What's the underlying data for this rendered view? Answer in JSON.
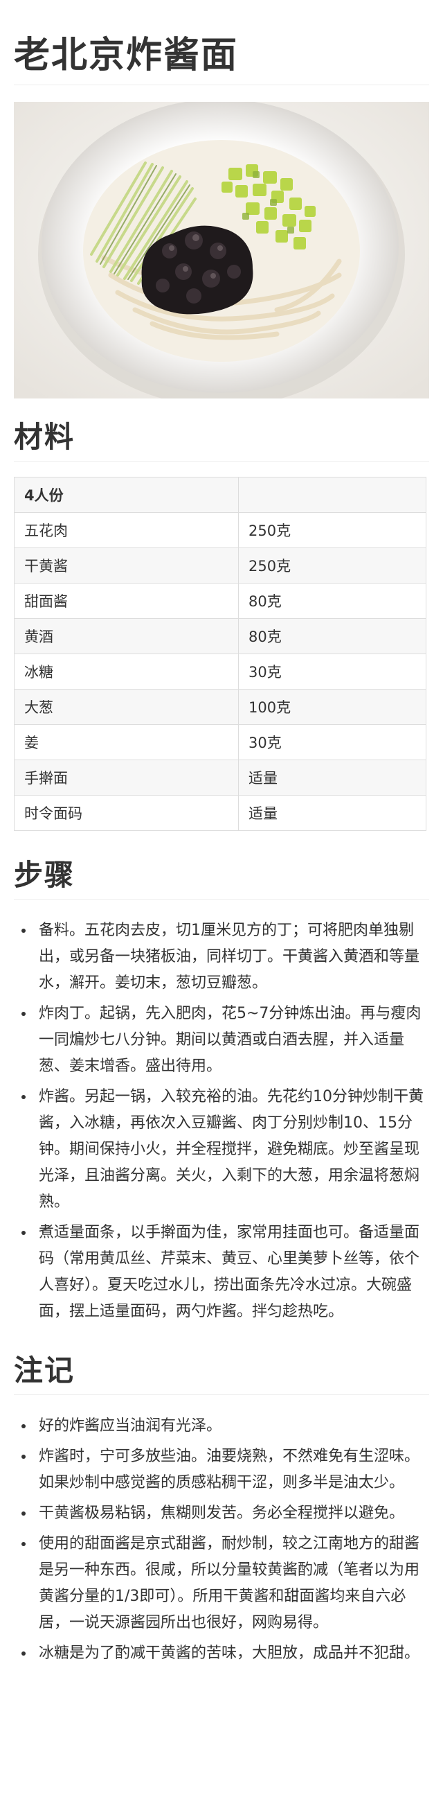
{
  "title": "老北京炸酱面",
  "hero_image": {
    "icon": "zhajiangmian-photo"
  },
  "materials": {
    "heading": "材料",
    "header": [
      "4人份",
      ""
    ],
    "rows": [
      [
        "五花肉",
        "250克"
      ],
      [
        "干黄酱",
        "250克"
      ],
      [
        "甜面酱",
        "80克"
      ],
      [
        "黄酒",
        "80克"
      ],
      [
        "冰糖",
        "30克"
      ],
      [
        "大葱",
        "100克"
      ],
      [
        "姜",
        "30克"
      ],
      [
        "手擀面",
        "适量"
      ],
      [
        "时令面码",
        "适量"
      ]
    ]
  },
  "steps": {
    "heading": "步骤",
    "items": [
      "备料。五花肉去皮，切1厘米见方的丁；可将肥肉单独剔出，或另备一块猪板油，同样切丁。干黄酱入黄酒和等量水，澥开。姜切末，葱切豆瓣葱。",
      "炸肉丁。起锅，先入肥肉，花5~7分钟炼出油。再与瘦肉一同煸炒七八分钟。期间以黄酒或白酒去腥，并入适量葱、姜末增香。盛出待用。",
      "炸酱。另起一锅，入较充裕的油。先花约10分钟炒制干黄酱，入冰糖，再依次入豆瓣酱、肉丁分别炒制10、15分钟。期间保持小火，并全程搅拌，避免糊底。炒至酱呈现光泽，且油酱分离。关火，入剩下的大葱，用余温将葱焖熟。",
      "煮适量面条，以手擀面为佳，家常用挂面也可。备适量面码（常用黄瓜丝、芹菜末、黄豆、心里美萝卜丝等，依个人喜好）。夏天吃过水儿，捞出面条先冷水过凉。大碗盛面，摆上适量面码，两勺炸酱。拌匀趁热吃。"
    ]
  },
  "notes": {
    "heading": "注记",
    "items": [
      "好的炸酱应当油润有光泽。",
      "炸酱时，宁可多放些油。油要烧熟，不然难免有生涩味。如果炒制中感觉酱的质感粘稠干涩，则多半是油太少。",
      "干黄酱极易粘锅，焦糊则发苦。务必全程搅拌以避免。",
      "使用的甜面酱是京式甜酱，耐炒制，较之江南地方的甜酱是另一种东西。很咸，所以分量较黄酱酌减（笔者以为用黄酱分量的1/3即可）。所用干黄酱和甜面酱均来自六必居，一说天源酱园所出也很好，网购易得。",
      "冰糖是为了酌减干黄酱的苦味，大胆放，成品并不犯甜。"
    ]
  }
}
